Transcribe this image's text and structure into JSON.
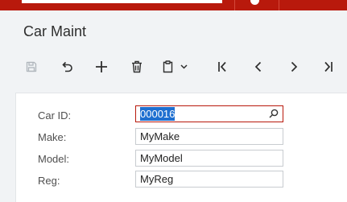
{
  "header": {
    "title": "Car Maint"
  },
  "toolbar": {
    "items": [
      {
        "name": "save",
        "icon": "save-icon",
        "enabled": false
      },
      {
        "name": "undo",
        "icon": "undo-icon",
        "enabled": true
      },
      {
        "name": "add",
        "icon": "plus-icon",
        "enabled": true
      },
      {
        "name": "delete",
        "icon": "trash-icon",
        "enabled": true
      },
      {
        "name": "copy-paste",
        "icon": "clipboard-icon",
        "enabled": true
      },
      {
        "name": "first",
        "icon": "first-record-icon",
        "enabled": true
      },
      {
        "name": "previous",
        "icon": "chevron-left-icon",
        "enabled": true
      },
      {
        "name": "next",
        "icon": "chevron-right-icon",
        "enabled": true
      },
      {
        "name": "last",
        "icon": "last-record-icon",
        "enabled": true
      }
    ]
  },
  "form": {
    "car_id": {
      "label": "Car ID:",
      "value": "000016"
    },
    "make": {
      "label": "Make:",
      "value": "MyMake"
    },
    "model": {
      "label": "Model:",
      "value": "MyModel"
    },
    "reg": {
      "label": "Reg:",
      "value": "MyReg"
    }
  },
  "colors": {
    "brand": "#b8190c",
    "selection": "#1e6fd0",
    "page_bg": "#f1f3f5"
  }
}
